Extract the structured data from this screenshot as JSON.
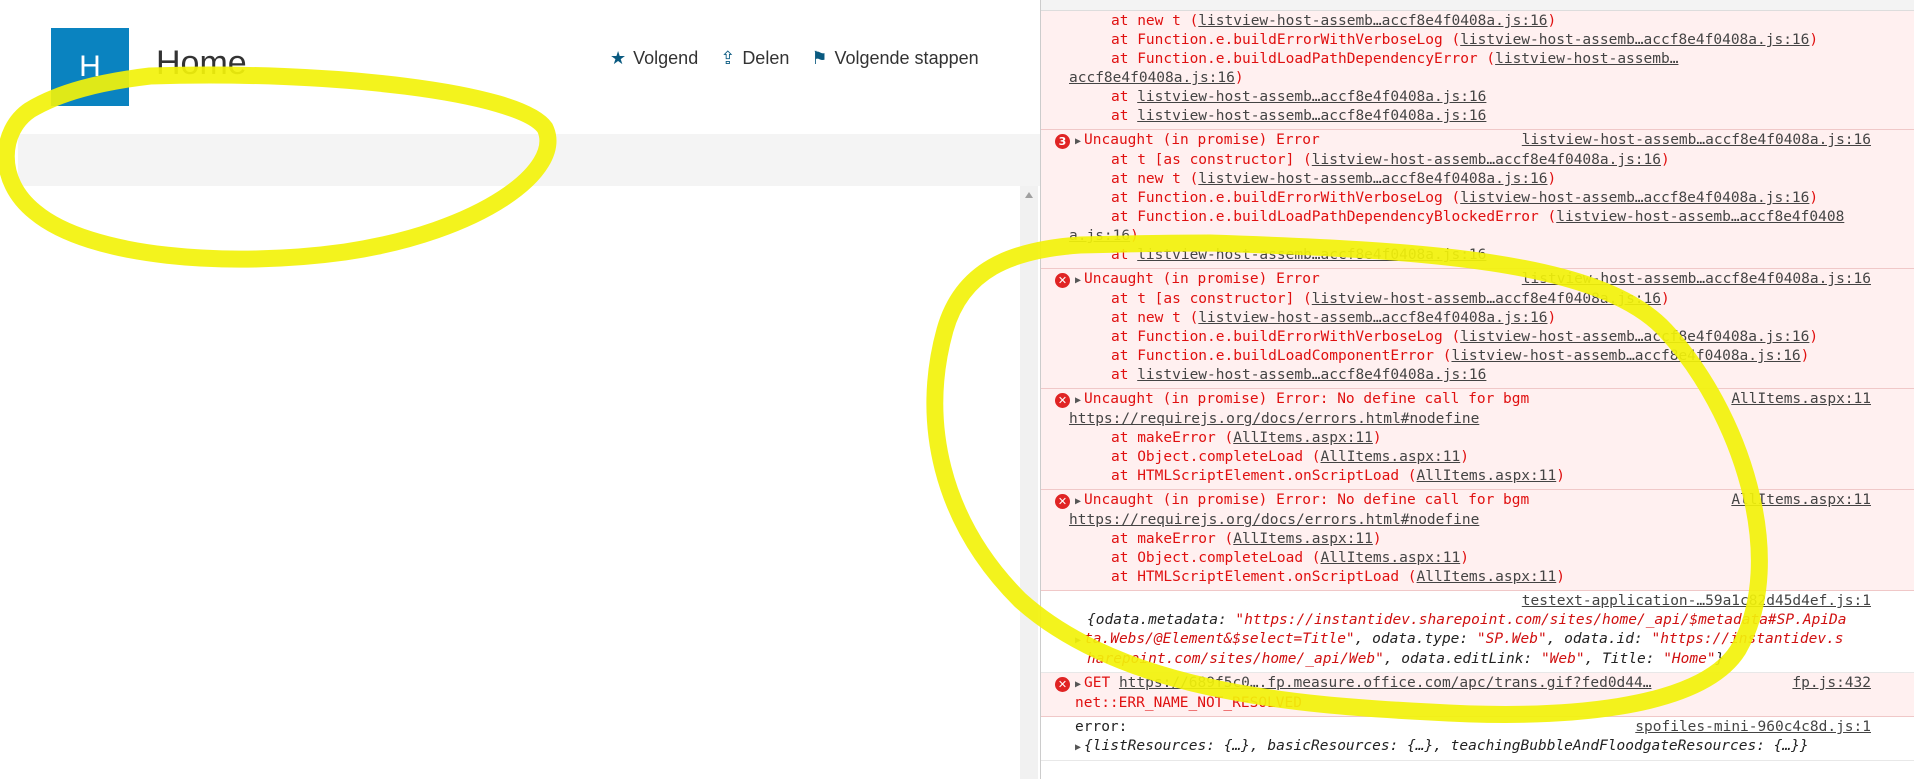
{
  "sharepoint": {
    "logo_letter": "H",
    "site_title": "Home",
    "actions": [
      {
        "icon": "star-icon",
        "glyph": "★",
        "label": "Volgend"
      },
      {
        "icon": "share-icon",
        "glyph": "⇪",
        "label": "Delen"
      },
      {
        "icon": "megaphone-icon",
        "glyph": "⚑",
        "label": "Volgende stappen"
      }
    ]
  },
  "console": {
    "entries": [
      {
        "kind": "error-tail",
        "lines": [
          [
            "at new t (",
            "listview-host-assemb…accf8e4f0408a.js:16",
            ")"
          ],
          [
            "at Function.e.buildErrorWithVerboseLog (",
            "listview-host-assemb…accf8e4f0408a.js:16",
            ")"
          ],
          [
            "at Function.e.buildLoadPathDependencyError (",
            "listview-host-assemb…",
            ""
          ],
          [
            "",
            "accf8e4f0408a.js:16",
            ")"
          ],
          [
            "at ",
            "listview-host-assemb…accf8e4f0408a.js:16",
            ""
          ],
          [
            "at ",
            "listview-host-assemb…accf8e4f0408a.js:16",
            ""
          ]
        ]
      },
      {
        "kind": "error",
        "count": "3",
        "title": "Uncaught (in promise) Error",
        "source": "listview-host-assemb…accf8e4f0408a.js:16",
        "lines": [
          [
            "at t [as constructor] (",
            "listview-host-assemb…accf8e4f0408a.js:16",
            ")"
          ],
          [
            "at new t (",
            "listview-host-assemb…accf8e4f0408a.js:16",
            ")"
          ],
          [
            "at Function.e.buildErrorWithVerboseLog (",
            "listview-host-assemb…accf8e4f0408a.js:16",
            ")"
          ],
          [
            "at Function.e.buildLoadPathDependencyBlockedError (",
            "listview-host-assemb…accf8e4f0408",
            ""
          ],
          [
            "",
            "a.js:16",
            ")"
          ],
          [
            "at ",
            "listview-host-assemb…accf8e4f0408a.js:16",
            ""
          ]
        ]
      },
      {
        "kind": "error",
        "count": "",
        "title": "Uncaught (in promise) Error",
        "source": "listview-host-assemb…accf8e4f0408a.js:16",
        "lines": [
          [
            "at t [as constructor] (",
            "listview-host-assemb…accf8e4f0408a.js:16",
            ")"
          ],
          [
            "at new t (",
            "listview-host-assemb…accf8e4f0408a.js:16",
            ")"
          ],
          [
            "at Function.e.buildErrorWithVerboseLog (",
            "listview-host-assemb…accf8e4f0408a.js:16",
            ")"
          ],
          [
            "at Function.e.buildLoadComponentError (",
            "listview-host-assemb…accf8e4f0408a.js:16",
            ")"
          ],
          [
            "at ",
            "listview-host-assemb…accf8e4f0408a.js:16",
            ""
          ]
        ]
      },
      {
        "kind": "error",
        "count": "",
        "title": "Uncaught (in promise) Error: No define call for bgm",
        "source": "AllItems.aspx:11",
        "link": "https://requirejs.org/docs/errors.html#nodefine",
        "lines": [
          [
            "at makeError (",
            "AllItems.aspx:11",
            ")"
          ],
          [
            "at Object.completeLoad (",
            "AllItems.aspx:11",
            ")"
          ],
          [
            "at HTMLScriptElement.onScriptLoad (",
            "AllItems.aspx:11",
            ")"
          ]
        ]
      },
      {
        "kind": "error",
        "count": "",
        "title": "Uncaught (in promise) Error: No define call for bgm",
        "source": "AllItems.aspx:11",
        "link": "https://requirejs.org/docs/errors.html#nodefine",
        "lines": [
          [
            "at makeError (",
            "AllItems.aspx:11",
            ")"
          ],
          [
            "at Object.completeLoad (",
            "AllItems.aspx:11",
            ")"
          ],
          [
            "at HTMLScriptElement.onScriptLoad (",
            "AllItems.aspx:11",
            ")"
          ]
        ]
      }
    ],
    "log_entry": {
      "source": "testext-application-…59a1c82d45d4ef.js:1",
      "line1": "{odata.metadata: ",
      "str1": "\"https://instantidev.sharepoint.com/sites/home/_api/$metadata#SP.ApiDa",
      "str1b": "ta.Webs/@Element&$select=Title\"",
      "mid1": ", odata.type: ",
      "str2": "\"SP.Web\"",
      "mid2": ", odata.id: ",
      "str3": "\"https://instantidev.s",
      "str3b": "harepoint.com/sites/home/_api/Web\"",
      "mid3": ", odata.editLink: ",
      "str4": "\"Web\"",
      "mid4": ", Title: ",
      "str5": "\"Home\"",
      "end": "}"
    },
    "get_entry": {
      "method": "GET ",
      "url": "https://689f5c0….fp.measure.office.com/apc/trans.gif?fed0d44…",
      "source": "fp.js:432",
      "error": "net::ERR_NAME_NOT_RESOLVED"
    },
    "last_entry": {
      "label": "error:",
      "source": "spofiles-mini-960c4c8d.js:1",
      "object": "{listResources: {…}, basicResources: {…}, teachingBubbleAndFloodgateResources: {…}}"
    }
  }
}
